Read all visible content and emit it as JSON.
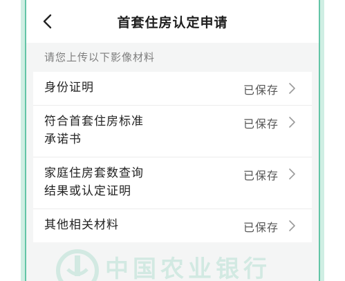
{
  "header": {
    "title": "首套住房认定申请",
    "back_icon": "chevron-left-icon"
  },
  "section_label": "请您上传以下影像材料",
  "items": [
    {
      "label": "身份证明",
      "status": "已保存"
    },
    {
      "label": "符合首套住房标准承诺书",
      "status": "已保存"
    },
    {
      "label": "家庭住房套数查询结果或认定证明",
      "status": "已保存"
    },
    {
      "label": "其他相关材料",
      "status": "已保存"
    }
  ],
  "watermark": {
    "text": "中国农业银行"
  },
  "colors": {
    "frame": "#63c4a6",
    "background": "#f4f5f5",
    "watermark": "#b7e1d3"
  }
}
